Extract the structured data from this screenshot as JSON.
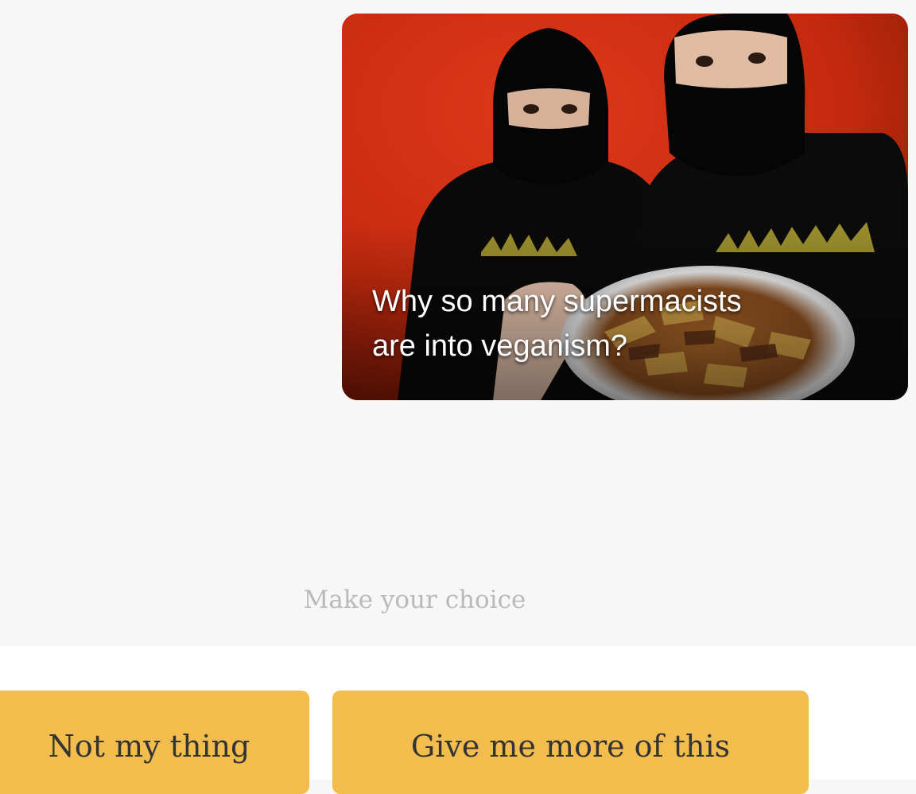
{
  "video": {
    "title_line1": "Why so many supermacists",
    "title_line2": "are into veganism?",
    "thumbnail_icon": "video-thumbnail-image"
  },
  "prompt": {
    "text": "Make your choice"
  },
  "choices": {
    "not_my_thing": "Not my thing",
    "more_of_this": "Give me more of this"
  },
  "colors": {
    "background": "#f7f7f7",
    "accent_button": "#f2bd4c",
    "thumbnail_red": "#c42a0e"
  }
}
